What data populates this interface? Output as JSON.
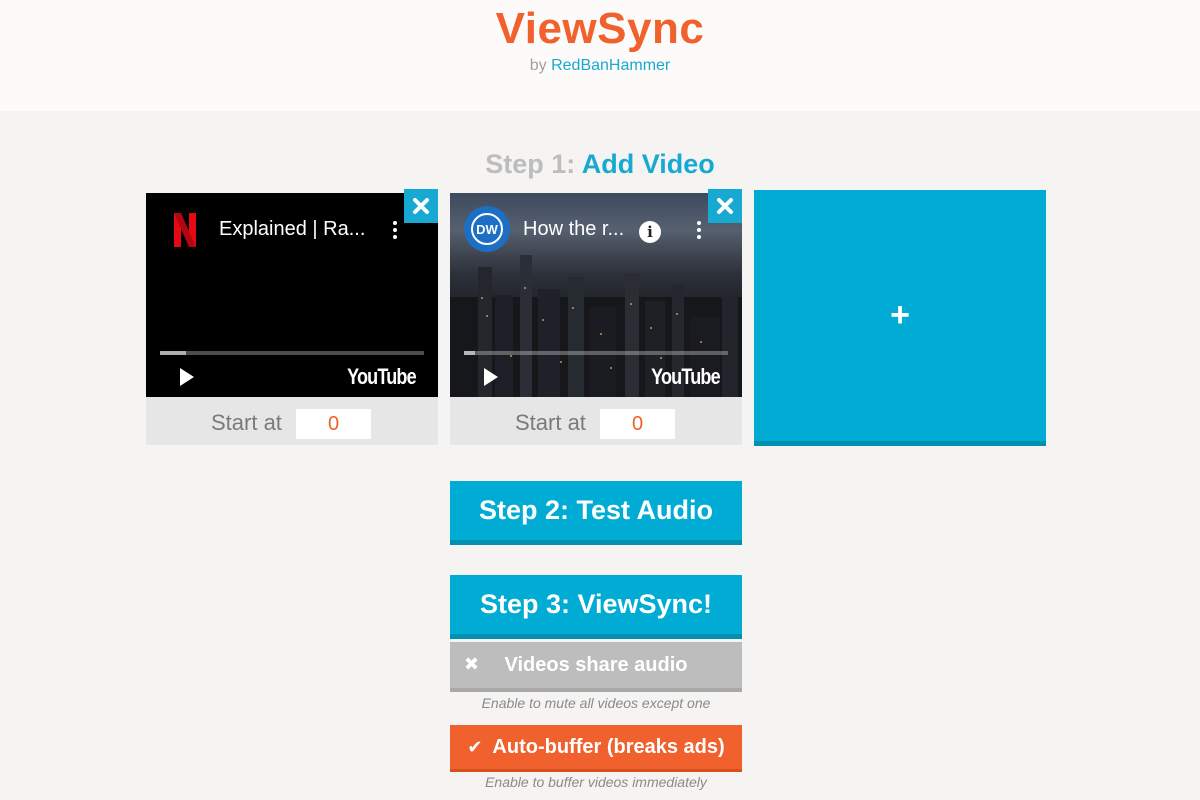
{
  "header": {
    "title": "ViewSync",
    "by_prefix": "by",
    "author": "RedBanHammer"
  },
  "step1": {
    "prefix": "Step 1:",
    "label": "Add Video"
  },
  "videos": [
    {
      "title": "Explained | Ra...",
      "channel_icon": "netflix-logo-icon",
      "platform": "YouTube",
      "start_label": "Start at",
      "start_value": "0",
      "progress": 0.1
    },
    {
      "title": "How the r...",
      "channel_icon": "dw-logo-icon",
      "channel_logo_text": "DW",
      "platform": "YouTube",
      "start_label": "Start at",
      "start_value": "0",
      "progress": 0.04
    }
  ],
  "add_video": {
    "icon": "plus-icon",
    "symbol": "+"
  },
  "step2": {
    "label": "Step 2: Test Audio"
  },
  "step3": {
    "label": "Step 3: ViewSync!"
  },
  "share_audio": {
    "label": "Videos share audio",
    "icon": "close-icon",
    "enabled": false,
    "hint": "Enable to mute all videos except one"
  },
  "auto_buffer": {
    "label": "Auto-buffer (breaks ads)",
    "icon": "check-icon",
    "enabled": true,
    "hint": "Enable to buffer videos immediately"
  },
  "colors": {
    "accent_orange": "#f0612e",
    "accent_blue": "#00acd4",
    "link_blue": "#18a9d3",
    "disabled_gray": "#bdbdbd"
  }
}
